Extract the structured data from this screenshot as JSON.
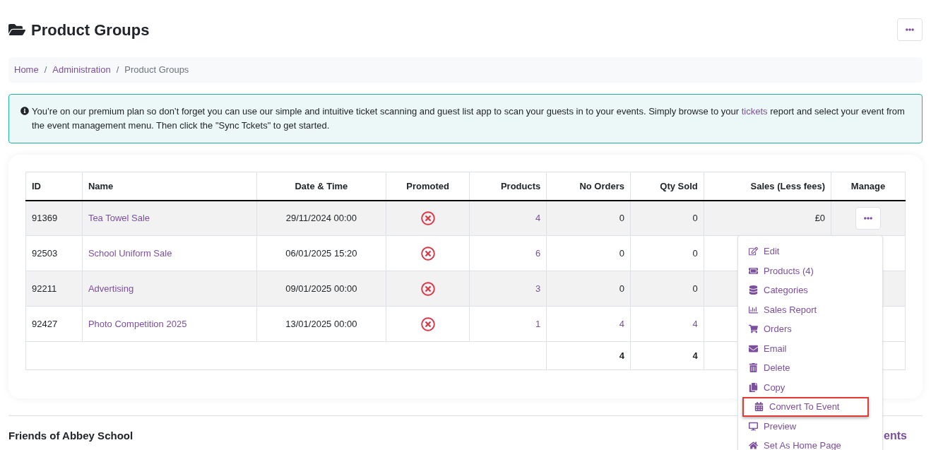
{
  "page": {
    "title": "Product Groups"
  },
  "breadcrumb": [
    {
      "label": "Home",
      "link": true
    },
    {
      "separator": "/",
      "label": "Administration",
      "link": true
    },
    {
      "separator": "/",
      "label": "Product Groups",
      "link": false
    }
  ],
  "alert": {
    "before": "You’re on our premium plan so don’t forget you can use our simple and intuitive ticket scanning and guest list app to scan your guests in to your events. Simply browse to your",
    "link": "tickets",
    "after": "report and select your event from the event management menu. Then click the \"Sync Tckets\" to get started."
  },
  "table": {
    "columns": [
      "ID",
      "Name",
      "Date & Time",
      "Promoted",
      "Products",
      "No Orders",
      "Qty Sold",
      "Sales (Less fees)",
      "Manage"
    ],
    "rows": [
      {
        "id": "91369",
        "name": "Tea Towel Sale",
        "date": "29/11/2024 00:00",
        "promoted": false,
        "products": "4",
        "orders": {
          "text": "0",
          "link": false
        },
        "qty": {
          "text": "0",
          "link": false
        },
        "sales": "£0",
        "manage_button": true
      },
      {
        "id": "92503",
        "name": "School Uniform Sale",
        "date": "06/01/2025 15:20",
        "promoted": false,
        "products": "6",
        "orders": {
          "text": "0",
          "link": false
        },
        "qty": {
          "text": "0",
          "link": false
        }
      },
      {
        "id": "92211",
        "name": "Advertising",
        "date": "09/01/2025 00:00",
        "promoted": false,
        "products": "3",
        "orders": {
          "text": "0",
          "link": false
        },
        "qty": {
          "text": "0",
          "link": false
        }
      },
      {
        "id": "92427",
        "name": "Photo Competition 2025",
        "date": "13/01/2025 00:00",
        "promoted": false,
        "products": "1",
        "orders": {
          "text": "4",
          "link": true
        },
        "qty": {
          "text": "4",
          "link": true
        }
      }
    ],
    "totals": {
      "orders": "4",
      "qty": "4"
    }
  },
  "menu": [
    {
      "kind": "edit",
      "label": "Edit",
      "highlighted": false
    },
    {
      "kind": "ticket",
      "label": "Products (4)",
      "highlighted": false
    },
    {
      "kind": "database",
      "label": "Categories",
      "highlighted": false
    },
    {
      "kind": "chart",
      "label": "Sales Report",
      "highlighted": false
    },
    {
      "kind": "cart",
      "label": "Orders",
      "highlighted": false
    },
    {
      "kind": "envelope",
      "label": "Email",
      "highlighted": false
    },
    {
      "kind": "trash",
      "label": "Delete",
      "highlighted": false
    },
    {
      "kind": "copy",
      "label": "Copy",
      "highlighted": false
    },
    {
      "kind": "calendar",
      "label": "Convert To Event",
      "highlighted": true
    },
    {
      "kind": "monitor",
      "label": "Preview",
      "highlighted": false
    },
    {
      "kind": "home",
      "label": "Set As Home Page",
      "highlighted": false
    }
  ],
  "footer": {
    "title": "Friends of Abbey School",
    "link": "ents"
  }
}
